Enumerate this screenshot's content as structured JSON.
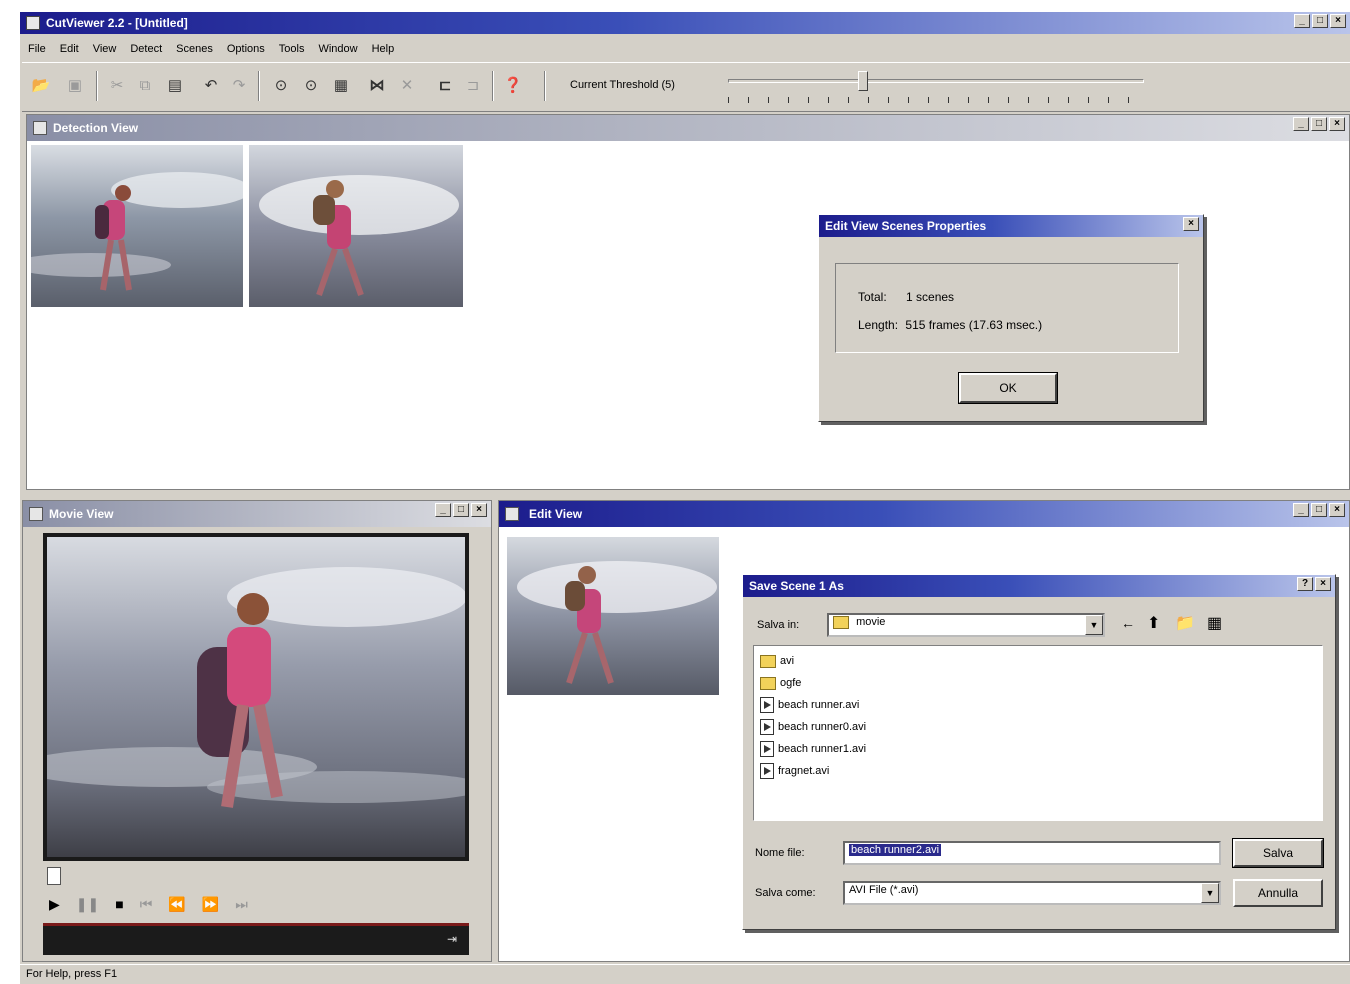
{
  "app": {
    "title": "CutViewer 2.2 - [Untitled]",
    "menu": [
      "File",
      "Edit",
      "View",
      "Detect",
      "Scenes",
      "Options",
      "Tools",
      "Window",
      "Help"
    ],
    "threshold_label": "Current Threshold (5)",
    "threshold_level": 0.32,
    "status_text": "For Help, press F1"
  },
  "icons": {
    "open": "folder-open-icon",
    "save": "save-icon",
    "cut": "scissors-icon",
    "copy": "copy-icon",
    "paste": "paste-icon",
    "undo": "undo-icon",
    "detect": "detect-icon",
    "merge": "merge-icon",
    "split": "split-icon",
    "help": "help-icon"
  },
  "detection_view": {
    "title": "Detection View"
  },
  "properties_dialog": {
    "title": "Edit View Scenes Properties",
    "total_label": "Total:",
    "total_value": "1 scenes",
    "length_label": "Length:",
    "length_value": "515 frames (17.63 msec.)",
    "ok_label": "OK"
  },
  "movie_view": {
    "title": "Movie View"
  },
  "edit_view": {
    "title": "Edit View"
  },
  "save_dialog": {
    "title": "Save Scene 1 As",
    "save_in_label": "Salva in:",
    "save_in_value": "movie",
    "files": [
      {
        "name": "avi",
        "kind": "folder"
      },
      {
        "name": "ogfe",
        "kind": "folder"
      },
      {
        "name": "beach runner.avi",
        "kind": "avi"
      },
      {
        "name": "beach runner0.avi",
        "kind": "avi"
      },
      {
        "name": "beach runner1.avi",
        "kind": "avi"
      },
      {
        "name": "fragnet.avi",
        "kind": "avi"
      }
    ],
    "filename_label": "Nome file:",
    "filename_value": "beach runner2.avi",
    "filetype_label": "Salva come:",
    "filetype_value": "AVI File (*.avi)",
    "save_button": "Salva",
    "cancel_button": "Annulla"
  },
  "colors": {
    "title_active": "#1c1c8c",
    "face": "#d4d0c8",
    "timeline": "#1b1b1b"
  }
}
